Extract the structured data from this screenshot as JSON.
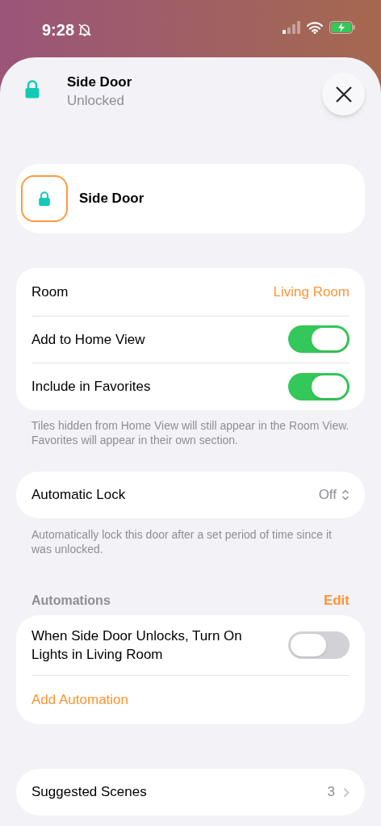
{
  "status_bar": {
    "time": "9:28"
  },
  "header": {
    "title": "Side Door",
    "subtitle": "Unlocked"
  },
  "accessory": {
    "name": "Side Door"
  },
  "settings": {
    "rows": [
      {
        "kind": "value",
        "label": "Room",
        "value": "Living Room"
      },
      {
        "kind": "toggle",
        "label": "Add to Home View",
        "on": true
      },
      {
        "kind": "toggle",
        "label": "Include in Favorites",
        "on": true
      }
    ],
    "footer": "Tiles hidden from Home View will still appear in the Room View. Favorites will appear in their own section."
  },
  "auto_lock": {
    "label": "Automatic Lock",
    "value": "Off",
    "footer": "Automatically lock this door after a set period of time since it was unlocked."
  },
  "automations": {
    "title": "Automations",
    "edit": "Edit",
    "items": [
      {
        "label": "When Side Door Unlocks, Turn On Lights in Living Room",
        "on": false
      }
    ],
    "add": "Add Automation"
  },
  "suggested_scenes": {
    "label": "Suggested Scenes",
    "count": "3"
  }
}
